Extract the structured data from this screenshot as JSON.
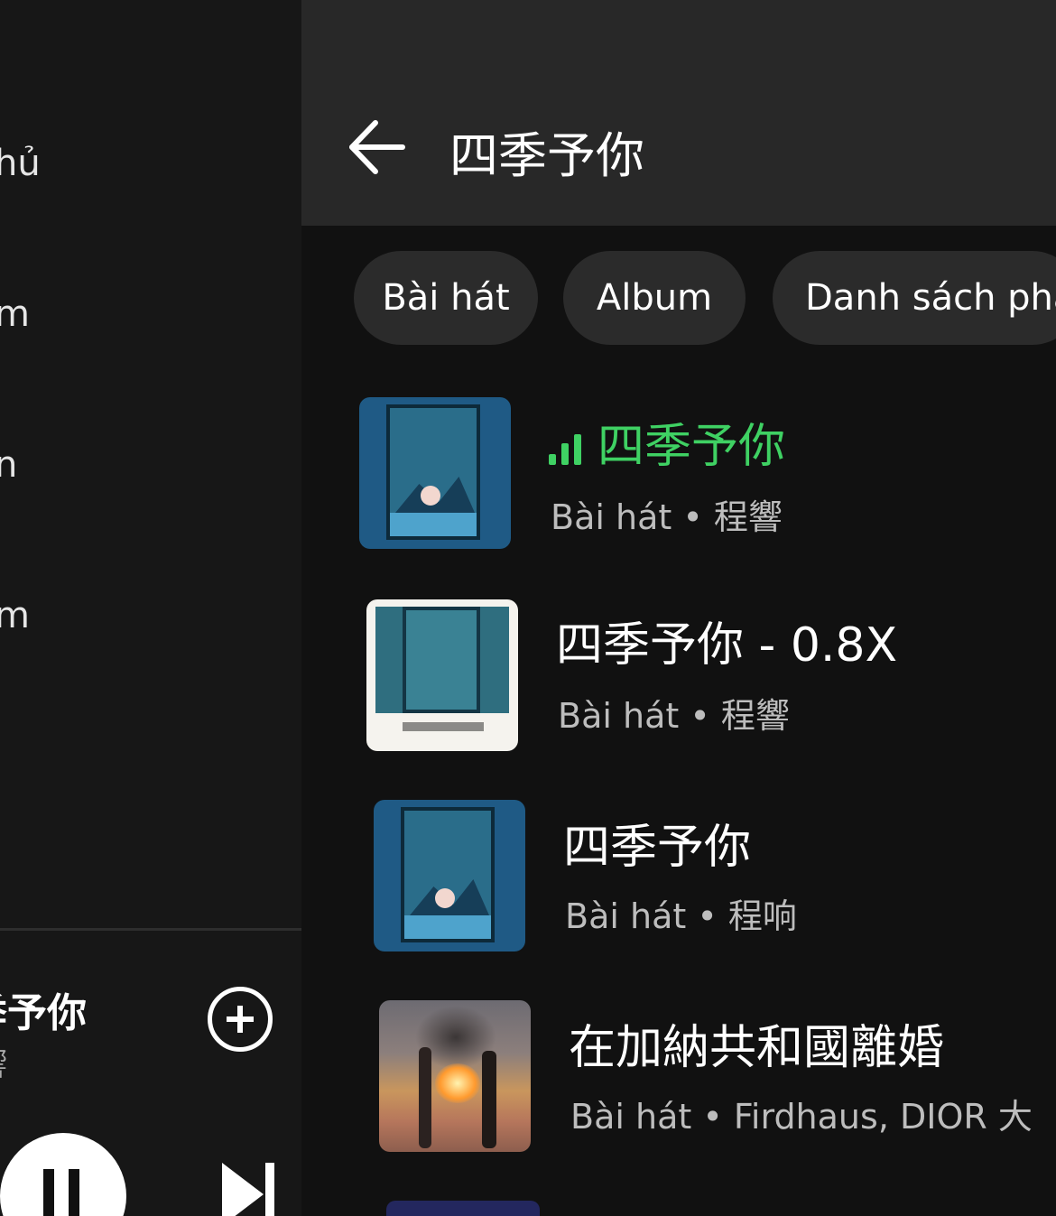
{
  "left_panel": {
    "menu_items": [
      {
        "label": "hủ"
      },
      {
        "label": "m"
      },
      {
        "label": "n"
      },
      {
        "label": "m"
      }
    ],
    "now_playing": {
      "title": "季予你",
      "artist": "響"
    }
  },
  "header": {
    "query": "四季予你"
  },
  "filters": [
    {
      "label": "Bài hát"
    },
    {
      "label": "Album"
    },
    {
      "label": "Danh sách phá"
    }
  ],
  "results": [
    {
      "title": "四季予你",
      "subtitle": "Bài hát • 程響",
      "playing": true,
      "cover": "blue-window-art"
    },
    {
      "title": "四季予你 - 0.8X",
      "subtitle": "Bài hát • 程響",
      "playing": false,
      "cover": "white-frame-art"
    },
    {
      "title": "四季予你",
      "subtitle": "Bài hát • 程响",
      "playing": false,
      "cover": "blue-window-art"
    },
    {
      "title": "在加納共和國離婚",
      "subtitle": "Bài hát • Firdhaus, DIOR 大",
      "playing": false,
      "cover": "beach-fire-photo"
    }
  ],
  "colors": {
    "accent": "#3fd163",
    "background": "#111111",
    "header": "#282828",
    "chip": "#2b2b2b"
  }
}
